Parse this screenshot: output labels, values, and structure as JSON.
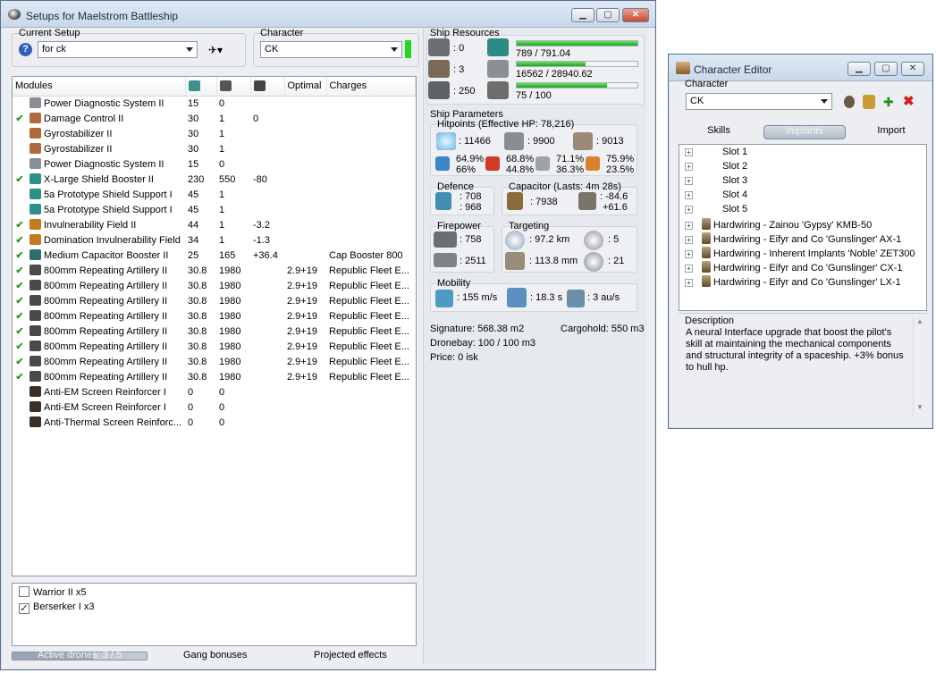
{
  "main": {
    "title": "Setups for Maelstrom Battleship",
    "current_setup_label": "Current Setup",
    "current_setup_value": "for ck",
    "character_label": "Character",
    "character_value": "CK",
    "modules_header": {
      "name": "Modules",
      "optimal": "Optimal",
      "charges": "Charges"
    },
    "modules": [
      {
        "checked": false,
        "name": "Power Diagnostic System II",
        "cpu": "15",
        "pg": "0",
        "cap": "",
        "optimal": "",
        "charges": "",
        "color": "#8a8f95"
      },
      {
        "checked": true,
        "name": "Damage Control II",
        "cpu": "30",
        "pg": "1",
        "cap": "0",
        "optimal": "",
        "charges": "",
        "color": "#b06a3b"
      },
      {
        "checked": false,
        "name": "Gyrostabilizer II",
        "cpu": "30",
        "pg": "1",
        "cap": "",
        "optimal": "",
        "charges": "",
        "color": "#b06a3b"
      },
      {
        "checked": false,
        "name": "Gyrostabilizer II",
        "cpu": "30",
        "pg": "1",
        "cap": "",
        "optimal": "",
        "charges": "",
        "color": "#b06a3b"
      },
      {
        "checked": false,
        "name": "Power Diagnostic System II",
        "cpu": "15",
        "pg": "0",
        "cap": "",
        "optimal": "",
        "charges": "",
        "color": "#8a8f95"
      },
      {
        "checked": true,
        "name": "X-Large Shield Booster II",
        "cpu": "230",
        "pg": "550",
        "cap": "-80",
        "optimal": "",
        "charges": "",
        "color": "#2f8f8a"
      },
      {
        "checked": false,
        "name": "5a Prototype Shield Support I",
        "cpu": "45",
        "pg": "1",
        "cap": "",
        "optimal": "",
        "charges": "",
        "color": "#2f8f8a"
      },
      {
        "checked": false,
        "name": "5a Prototype Shield Support I",
        "cpu": "45",
        "pg": "1",
        "cap": "",
        "optimal": "",
        "charges": "",
        "color": "#2f8f8a"
      },
      {
        "checked": true,
        "name": "Invulnerability Field II",
        "cpu": "44",
        "pg": "1",
        "cap": "-3.2",
        "optimal": "",
        "charges": "",
        "color": "#c27a1c"
      },
      {
        "checked": true,
        "name": "Domination Invulnerability Field",
        "cpu": "34",
        "pg": "1",
        "cap": "-1.3",
        "optimal": "",
        "charges": "",
        "color": "#c27a1c"
      },
      {
        "checked": true,
        "name": "Medium Capacitor Booster II",
        "cpu": "25",
        "pg": "165",
        "cap": "+36.4",
        "optimal": "",
        "charges": "Cap Booster 800",
        "color": "#2a6f6a"
      },
      {
        "checked": true,
        "name": "800mm Repeating Artillery II",
        "cpu": "30.8",
        "pg": "1980",
        "cap": "",
        "optimal": "2.9+19",
        "charges": "Republic Fleet E...",
        "color": "#4a4a4a"
      },
      {
        "checked": true,
        "name": "800mm Repeating Artillery II",
        "cpu": "30.8",
        "pg": "1980",
        "cap": "",
        "optimal": "2.9+19",
        "charges": "Republic Fleet E...",
        "color": "#4a4a4a"
      },
      {
        "checked": true,
        "name": "800mm Repeating Artillery II",
        "cpu": "30.8",
        "pg": "1980",
        "cap": "",
        "optimal": "2.9+19",
        "charges": "Republic Fleet E...",
        "color": "#4a4a4a"
      },
      {
        "checked": true,
        "name": "800mm Repeating Artillery II",
        "cpu": "30.8",
        "pg": "1980",
        "cap": "",
        "optimal": "2.9+19",
        "charges": "Republic Fleet E...",
        "color": "#4a4a4a"
      },
      {
        "checked": true,
        "name": "800mm Repeating Artillery II",
        "cpu": "30.8",
        "pg": "1980",
        "cap": "",
        "optimal": "2.9+19",
        "charges": "Republic Fleet E...",
        "color": "#4a4a4a"
      },
      {
        "checked": true,
        "name": "800mm Repeating Artillery II",
        "cpu": "30.8",
        "pg": "1980",
        "cap": "",
        "optimal": "2.9+19",
        "charges": "Republic Fleet E...",
        "color": "#4a4a4a"
      },
      {
        "checked": true,
        "name": "800mm Repeating Artillery II",
        "cpu": "30.8",
        "pg": "1980",
        "cap": "",
        "optimal": "2.9+19",
        "charges": "Republic Fleet E...",
        "color": "#4a4a4a"
      },
      {
        "checked": true,
        "name": "800mm Repeating Artillery II",
        "cpu": "30.8",
        "pg": "1980",
        "cap": "",
        "optimal": "2.9+19",
        "charges": "Republic Fleet E...",
        "color": "#4a4a4a"
      },
      {
        "checked": false,
        "name": "Anti-EM Screen Reinforcer I",
        "cpu": "0",
        "pg": "0",
        "cap": "",
        "optimal": "",
        "charges": "",
        "color": "#3a3026"
      },
      {
        "checked": false,
        "name": "Anti-EM Screen Reinforcer I",
        "cpu": "0",
        "pg": "0",
        "cap": "",
        "optimal": "",
        "charges": "",
        "color": "#3a3026"
      },
      {
        "checked": false,
        "name": "Anti-Thermal Screen Reinforc...",
        "cpu": "0",
        "pg": "0",
        "cap": "",
        "optimal": "",
        "charges": "",
        "color": "#3a3026"
      }
    ],
    "drones": [
      {
        "checked": false,
        "label": "Warrior II x5"
      },
      {
        "checked": true,
        "label": "Berserker I x3"
      }
    ],
    "bottom": {
      "active_drones": "Active drones: 3 / 5",
      "gang_bonuses": "Gang bonuses",
      "projected_effects": "Projected effects"
    },
    "ship_resources": {
      "label": "Ship Resources",
      "turrets": ": 0",
      "launchers": ": 3",
      "calibration": ": 250",
      "cpu": "789 / 791.04",
      "cpu_fraction": 0.997,
      "powergrid": "16562 / 28940.62",
      "powergrid_fraction": 0.572,
      "drone_bw": "75 / 100",
      "drone_bw_fraction": 0.75
    },
    "ship_parameters": {
      "label": "Ship Parameters",
      "hitpoints_label": "Hitpoints (Effective HP: 78,216)",
      "shield": ": 11466",
      "armor": ": 9900",
      "structure": ": 9013",
      "res": [
        {
          "a": "64.9%",
          "b": "66%"
        },
        {
          "a": "68.8%",
          "b": "44.8%"
        },
        {
          "a": "71.1%",
          "b": "36.3%"
        },
        {
          "a": "75.9%",
          "b": "23.5%"
        }
      ],
      "defence_label": "Defence",
      "defence_a": ": 708",
      "defence_b": ": 968",
      "capacitor_label": "Capacitor (Lasts: 4m 28s)",
      "capacitor_total": ": 7938",
      "capacitor_a": ": -84.6",
      "capacitor_b": "+61.6",
      "firepower_label": "Firepower",
      "fp_a": ": 758",
      "fp_b": ": 2511",
      "targeting_label": "Targeting",
      "range": ": 97.2 km",
      "targets": ": 5",
      "scan_res": ": 113.8 mm",
      "sensor": ": 21",
      "mobility_label": "Mobility",
      "speed": ": 155 m/s",
      "align": ": 18.3 s",
      "warp": ": 3 au/s"
    },
    "info": {
      "signature": "Signature: 568.38 m2",
      "cargohold": "Cargohold: 550 m3",
      "dronebay": "Dronebay: 100 / 100 m3",
      "price": "Price: 0 isk"
    }
  },
  "editor": {
    "title": "Character Editor",
    "character_label": "Character",
    "character_value": "CK",
    "tabs": [
      "Skills",
      "Implants",
      "Import"
    ],
    "tree": [
      {
        "label": "Slot 1",
        "icon": false
      },
      {
        "label": "Slot 2",
        "icon": false
      },
      {
        "label": "Slot 3",
        "icon": false
      },
      {
        "label": "Slot 4",
        "icon": false
      },
      {
        "label": "Slot 5",
        "icon": false
      },
      {
        "label": "Hardwiring - Zainou 'Gypsy' KMB-50",
        "icon": true
      },
      {
        "label": "Hardwiring - Eifyr and Co 'Gunslinger' AX-1",
        "icon": true
      },
      {
        "label": "Hardwiring - Inherent Implants 'Noble' ZET300",
        "icon": true
      },
      {
        "label": "Hardwiring - Eifyr and Co 'Gunslinger' CX-1",
        "icon": true
      },
      {
        "label": "Hardwiring - Eifyr and Co 'Gunslinger' LX-1",
        "icon": true
      }
    ],
    "description_label": "Description",
    "description": "A neural Interface upgrade that boost the pilot's skill at maintaining the mechanical components and structural integrity of a spaceship. +3% bonus to hull hp."
  }
}
